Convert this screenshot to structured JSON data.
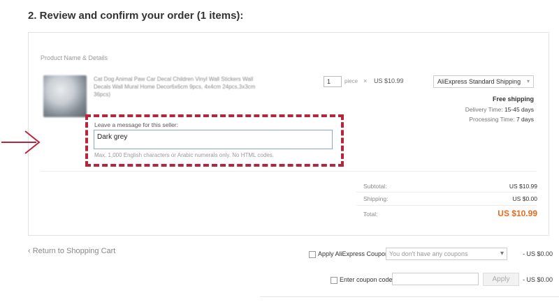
{
  "section": {
    "title": "2. Review and confirm your order (1 items):"
  },
  "order": {
    "column_header": "Product Name & Details",
    "product": {
      "name": "Cat Dog Animal Paw Car Decal Children Vinyl Wall Stickers Wall Decals Wall Mural Home Decor6x6cm 9pcs, 4x4cm 24pcs,3x3cm 36pcs)",
      "thumbnail_icon": "product-image"
    },
    "quantity": "1",
    "quantity_unit": "piece",
    "multiply_symbol": "×",
    "unit_price": "US $10.99",
    "shipping_method": "AliExpress Standard Shipping",
    "shipping_chevron": "▾",
    "free_shipping": "Free shipping",
    "delivery_time_label": "Delivery Time:",
    "delivery_time_value": "15-45 days",
    "processing_time_label": "Processing Time:",
    "processing_time_value": "7 days"
  },
  "message": {
    "label": "Leave a message for this seller:",
    "value": "Dark grey",
    "hint": "Max. 1,000 English characters or Arabic numerals only. No HTML codes."
  },
  "annotation": {
    "highlight_color": "#b5263c"
  },
  "summary": {
    "subtotal_label": "Subtotal:",
    "subtotal_value": "US $10.99",
    "shipping_label": "Shipping:",
    "shipping_value": "US $0.00",
    "total_label": "Total:",
    "total_value": "US $10.99",
    "total_color": "#e36c1e"
  },
  "footer": {
    "back_link": "‹ Return to Shopping Cart",
    "apply_coupon_label": "Apply AliExpress Coupon:",
    "coupon_select_value": "You don't have any coupons",
    "coupon_select_chevron": "▾",
    "coupon_discount": "- US $0.00",
    "enter_coupon_label": "Enter coupon code:",
    "coupon_code_value": "",
    "apply_button": "Apply",
    "code_discount": "- US $0.00"
  }
}
